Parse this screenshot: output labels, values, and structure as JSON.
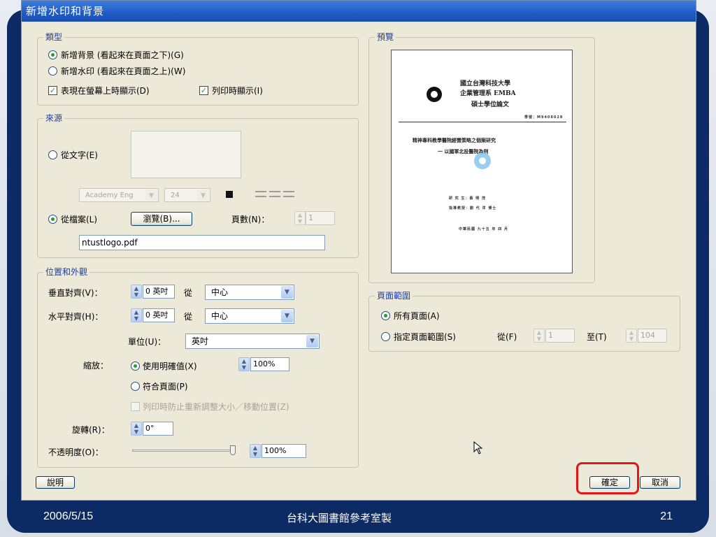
{
  "dialog": {
    "title": "新增水印和背景",
    "type_group": {
      "title": "類型",
      "opt_background": "新增背景 (看起來在頁面之下)(G)",
      "opt_watermark": "新增水印 (看起來在頁面之上)(W)",
      "chk_show_screen": "表現在螢幕上時顯示(D)",
      "chk_show_print": "列印時顯示(I)"
    },
    "source_group": {
      "title": "來源",
      "opt_text": "從文字(E)",
      "font_value": "Academy Eng",
      "size_value": "24",
      "opt_file": "從檔案(L)",
      "browse_button": "瀏覽(B)...",
      "page_label": "頁數(N)：",
      "page_value": "1",
      "file_value": "ntustlogo.pdf"
    },
    "position_group": {
      "title": "位置和外觀",
      "vertical_label": "垂直對齊(V)：",
      "vertical_value": "0 英吋",
      "vertical_from": "從",
      "vertical_ref": "中心",
      "horizontal_label": "水平對齊(H)：",
      "horizontal_value": "0 英吋",
      "horizontal_from": "從",
      "horizontal_ref": "中心",
      "unit_label": "單位(U)：",
      "unit_value": "英吋",
      "scale_label": "縮放：",
      "opt_explicit": "使用明確值(X)",
      "explicit_value": "100%",
      "opt_fit": "符合頁面(P)",
      "chk_prevent": "列印時防止重新調整大小／移動位置(Z)",
      "rotation_label": "旋轉(R)：",
      "rotation_value": "0°",
      "opacity_label": "不透明度(O)：",
      "opacity_value": "100%",
      "opacity_level": 1.0
    },
    "preview_group": {
      "title": "預覽",
      "paper": {
        "univ_name": "國立台灣科技大學",
        "dept_name": "企業管理系 EMBA",
        "degree": "碩士學位論文",
        "student_id": "學號：M9408028",
        "thesis_title": "精神專科教學醫院經營策略之個案研究",
        "thesis_subtitle": "一 以國軍北投醫院為例",
        "author_line": "研 究 生：蔡 明 茂",
        "advisor_line": "指導教授：劉 代 洋  博士",
        "date_line": "中華民國 九十五 年 四 月"
      }
    },
    "page_range_group": {
      "title": "頁面範圍",
      "opt_all": "所有頁面(A)",
      "opt_range": "指定頁面範圍(S)",
      "from_label": "從(F)",
      "from_value": "1",
      "to_label": "至(T)",
      "to_value": "104"
    },
    "help_button": "說明",
    "ok_button": "確定",
    "cancel_button": "取消"
  },
  "footer": {
    "date": "2006/5/15",
    "credit": "台科大圖書館參考室製",
    "page_number": "21"
  },
  "colors": {
    "slide_frame": "#0c2a63",
    "titlebar": "#1f5bc6",
    "group_title": "#1e3ea8",
    "highlight": "#e01818"
  }
}
